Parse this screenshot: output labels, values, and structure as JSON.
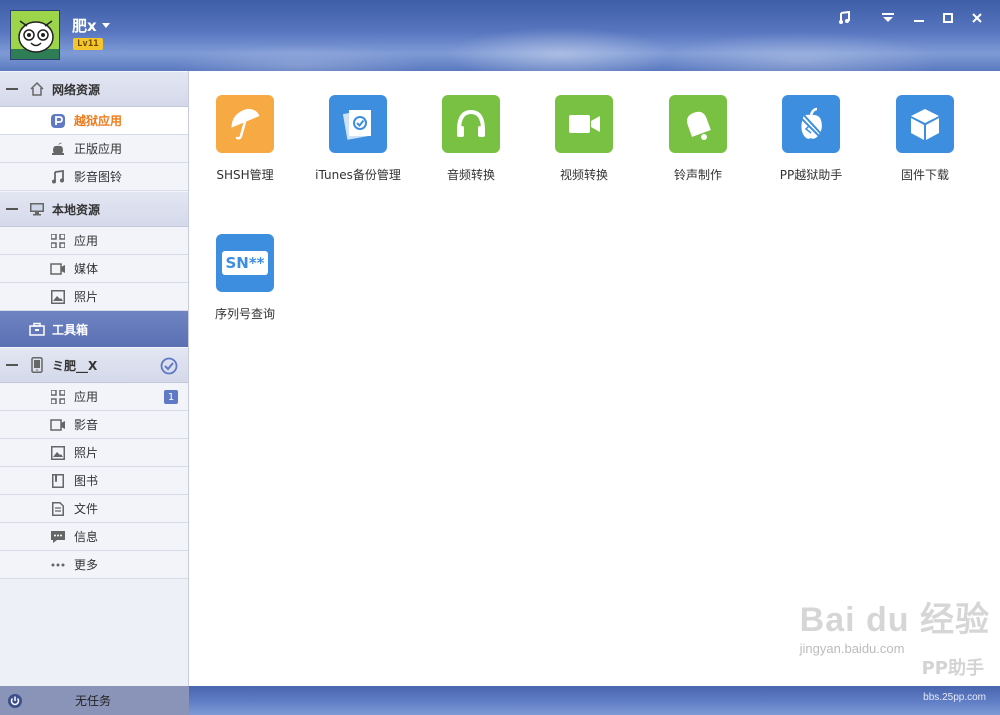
{
  "user": {
    "name": "肥x",
    "level": "Lv11"
  },
  "sidebar": {
    "groups": [
      {
        "label": "网络资源",
        "items": [
          {
            "label": "越狱应用"
          },
          {
            "label": "正版应用"
          },
          {
            "label": "影音图铃"
          }
        ]
      },
      {
        "label": "本地资源",
        "items": [
          {
            "label": "应用"
          },
          {
            "label": "媒体"
          },
          {
            "label": "照片"
          }
        ]
      },
      {
        "label": "工具箱"
      },
      {
        "label": "ミ肥__X",
        "items": [
          {
            "label": "应用",
            "badge": "1"
          },
          {
            "label": "影音"
          },
          {
            "label": "照片"
          },
          {
            "label": "图书"
          },
          {
            "label": "文件"
          },
          {
            "label": "信息"
          },
          {
            "label": "更多"
          }
        ]
      }
    ]
  },
  "status": {
    "task": "无任务"
  },
  "tools": [
    {
      "label": "SHSH管理",
      "icon": "umbrella-icon",
      "color": "#f7a943"
    },
    {
      "label": "iTunes备份管理",
      "icon": "backup-icon",
      "color": "#3e8ee0"
    },
    {
      "label": "音频转换",
      "icon": "headphones-icon",
      "color": "#79c142"
    },
    {
      "label": "视频转换",
      "icon": "video-camera-icon",
      "color": "#79c142"
    },
    {
      "label": "铃声制作",
      "icon": "bell-icon",
      "color": "#79c142"
    },
    {
      "label": "PP越狱助手",
      "icon": "jailbreak-icon",
      "color": "#3e8ee0"
    },
    {
      "label": "固件下载",
      "icon": "cube-icon",
      "color": "#3e8ee0"
    },
    {
      "label": "序列号查询",
      "icon": "serial-number-icon",
      "color": "#3e8ee0"
    }
  ],
  "serial_icon_text": "SN**",
  "watermark": {
    "brand": "Bai du 经验",
    "sub": "jingyan.baidu.com",
    "overlay": "PP助手",
    "site": "bbs.25pp.com"
  }
}
